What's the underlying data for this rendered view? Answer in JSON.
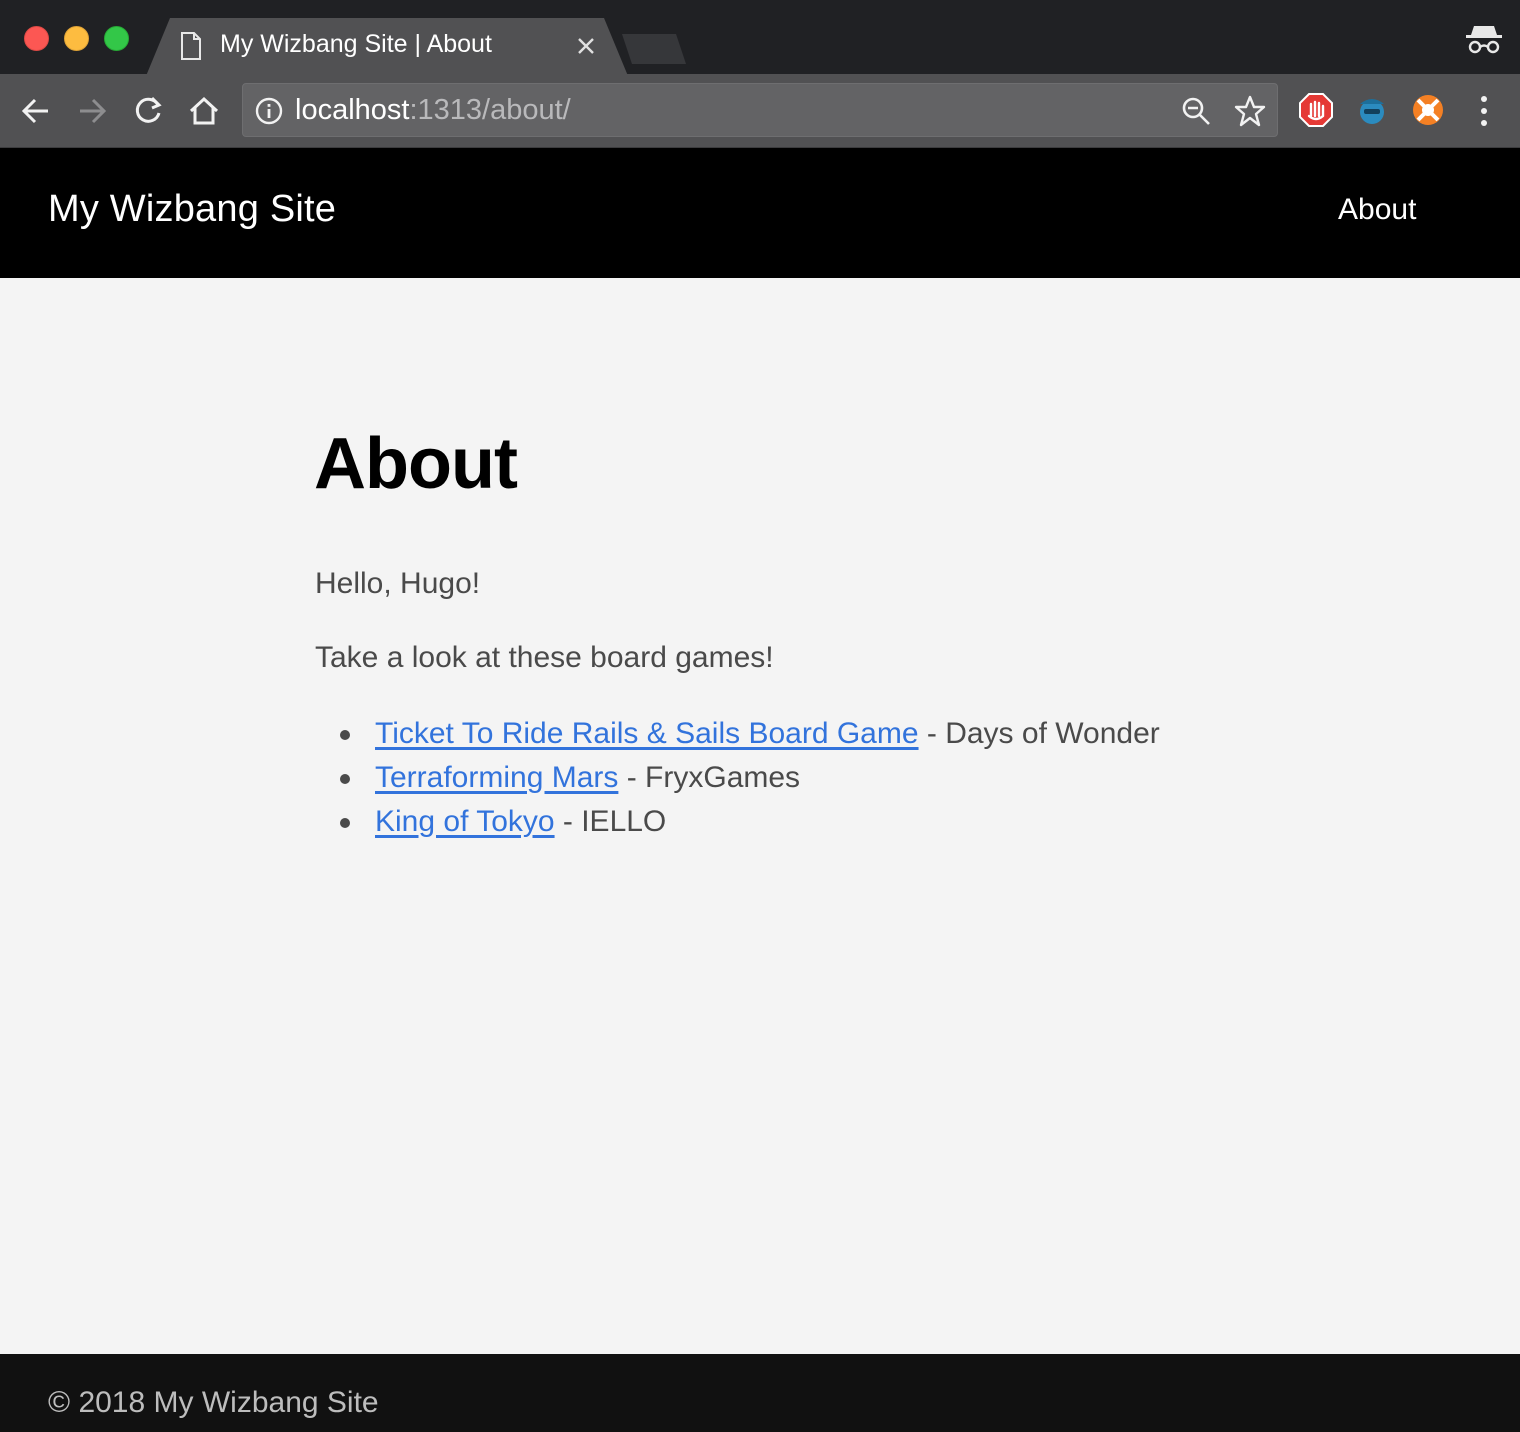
{
  "browser": {
    "tab_title": "My Wizbang Site | About",
    "url_host": "localhost",
    "url_rest": ":1313/about/",
    "icons": [
      "page-icon",
      "close-icon",
      "incognito-icon",
      "back-icon",
      "forward-icon",
      "reload-icon",
      "home-icon",
      "info-icon",
      "zoom-out-icon",
      "bookmark-star-icon",
      "adblock-icon",
      "extension-spy-icon",
      "extension-lifebuoy-icon",
      "menu-dots-icon"
    ]
  },
  "site": {
    "title": "My Wizbang Site",
    "nav": [
      {
        "label": "About"
      }
    ]
  },
  "page": {
    "title": "About",
    "intro": "Hello, Hugo!",
    "lead": "Take a look at these board games!",
    "games": [
      {
        "name": "Ticket To Ride Rails & Sails Board Game",
        "publisher": " - Days of Wonder"
      },
      {
        "name": "Terraforming Mars",
        "publisher": " - FryxGames"
      },
      {
        "name": "King of Tokyo",
        "publisher": " - IELLO"
      }
    ]
  },
  "footer": {
    "text": "© 2018 My Wizbang Site"
  },
  "colors": {
    "link": "#3273dc",
    "header_bg": "#000000",
    "page_bg": "#f4f4f4",
    "footer_bg": "#111111"
  }
}
